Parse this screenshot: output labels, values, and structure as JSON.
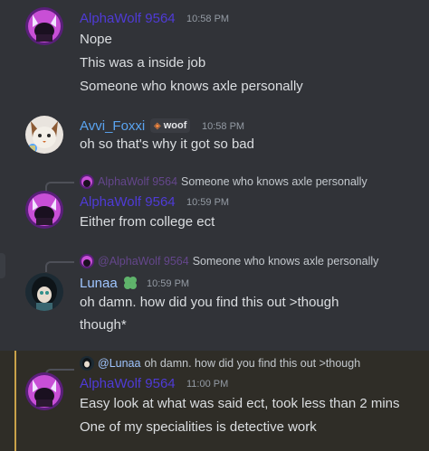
{
  "colors": {
    "background": "#313338",
    "alphawolf_name": "#4f3bd6",
    "avvi_name": "#5aa4f0",
    "lunaa_name": "#9fc5ff",
    "timestamp": "#949ba4",
    "text": "#dbdee1",
    "mention_highlight": "#c9a24a"
  },
  "messages": [
    {
      "author": "AlphaWolf 9564",
      "timestamp": "10:58 PM",
      "lines": [
        "Nope",
        "This was a inside job",
        "Someone who knows axle personally"
      ]
    },
    {
      "author": "Avvi_Foxxi",
      "role_tag": "woof",
      "timestamp": "10:58 PM",
      "lines": [
        "oh so that's why it got so bad"
      ]
    },
    {
      "reply_to": {
        "author": "AlphaWolf 9564",
        "text": "Someone who knows axle personally"
      },
      "author": "AlphaWolf 9564",
      "timestamp": "10:59 PM",
      "lines": [
        "Either from college ect"
      ]
    },
    {
      "reply_to": {
        "author": "@AlphaWolf 9564",
        "text": "Someone who knows axle personally"
      },
      "author": "Lunaa",
      "author_badge": "clover-icon",
      "timestamp": "10:59 PM",
      "lines": [
        "oh damn. how did you find this out >though",
        "though*"
      ]
    },
    {
      "reply_to": {
        "author": "@Lunaa",
        "text": "oh damn. how did you find this out >though"
      },
      "author": "AlphaWolf 9564",
      "timestamp": "11:00 PM",
      "lines": [
        "Easy look at what was said ect, took less than 2 mins",
        "One of my specialities is detective work"
      ]
    }
  ]
}
